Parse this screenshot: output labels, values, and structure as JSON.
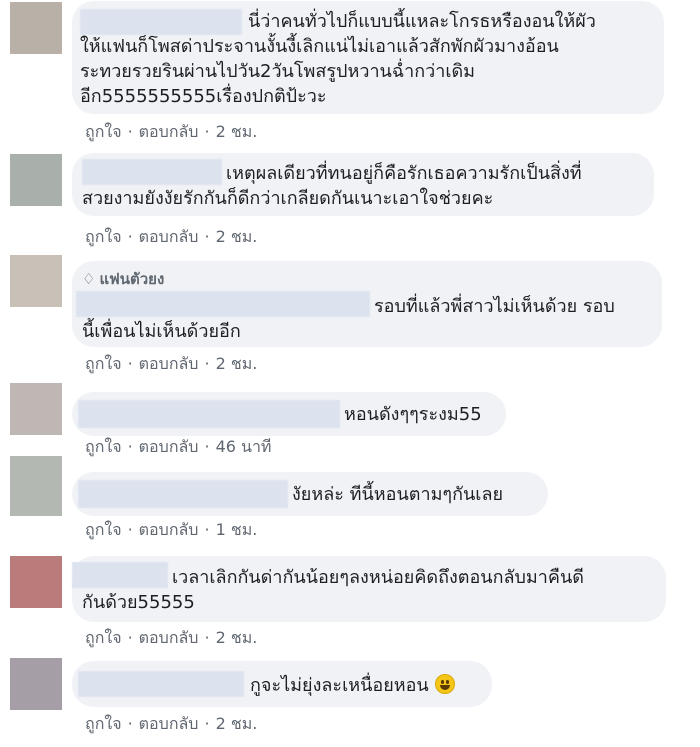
{
  "comments": [
    {
      "lines": [
        "นี่ว่าคนทั่วไปก็แบบนี้แหละโกรธหรืองอนให้ผัว",
        "ให้แฟนก็โพสด่าประจานงั้นงี้เลิกแน่ไม่เอาแล้วสักพักผัวมางอ้อน",
        "ระทวยรวยรินผ่านไปวัน2วันโพสรูปหวานฉ่ำกว่าเดิม",
        "อีก5555555555เรื่องปกติป้ะวะ"
      ],
      "like": "ถูกใจ",
      "reply": "ตอบกลับ",
      "time": "2 ชม.",
      "avatar_color": "#b9b0a8"
    },
    {
      "lines": [
        "เหตุผลเดียวที่ทนอยู่ก็คือรักเธอความรักเป็นสิ่งที่",
        "สวยงามยังงัยรักกันก็ดีกว่าเกลียดกันเนาะเอาใจช่วยคะ"
      ],
      "like": "ถูกใจ",
      "reply": "ตอบกลับ",
      "time": "2 ชม.",
      "avatar_color": "#a9b0ab"
    },
    {
      "badge": "แฟนตัวยง",
      "lines": [
        "รอบที่แล้วพี่สาวไม่เห็นด้วย รอบ",
        "นี้เพื่อนไม่เห็นด้วยอีก"
      ],
      "like": "ถูกใจ",
      "reply": "ตอบกลับ",
      "time": "2 ชม.",
      "avatar_color": "#c9c1b8"
    },
    {
      "lines": [
        "หอนดังๆๆระงม55"
      ],
      "like": "ถูกใจ",
      "reply": "ตอบกลับ",
      "time": "46 นาที",
      "avatar_color": "#bfb7b4"
    },
    {
      "lines": [
        "งัยหล่ะ ทีนี้หอนตามๆกันเลย"
      ],
      "like": "ถูกใจ",
      "reply": "ตอบกลับ",
      "time": "1 ชม.",
      "avatar_color": "#b4b8b3"
    },
    {
      "lines": [
        "เวลาเลิกกันด่ากันน้อยๆลงหน่อยคิดถึงตอนกลับมาคืนดี",
        "กันด้วย55555"
      ],
      "like": "ถูกใจ",
      "reply": "ตอบกลับ",
      "time": "2 ชม.",
      "avatar_color": "#b97c7a"
    },
    {
      "lines": [
        "กูจะไม่ยุ่งละเหนื่อยหอน"
      ],
      "emoji": "smiling-face",
      "like": "ถูกใจ",
      "reply": "ตอบกลับ",
      "time": "2 ชม.",
      "avatar_color": "#a69ea6"
    }
  ]
}
